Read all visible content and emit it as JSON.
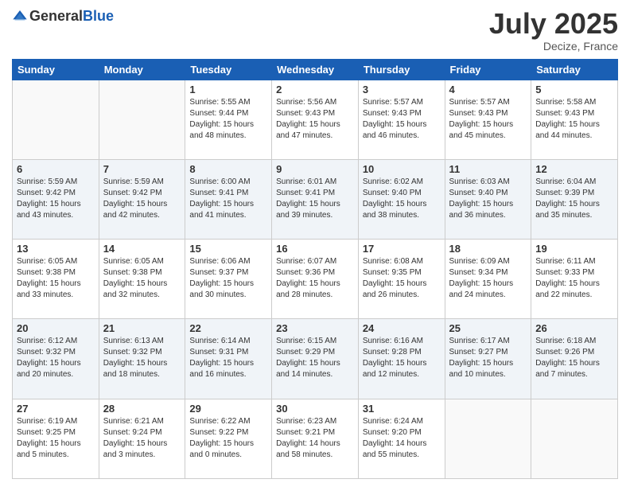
{
  "header": {
    "logo_general": "General",
    "logo_blue": "Blue",
    "month_year": "July 2025",
    "location": "Decize, France"
  },
  "weekdays": [
    "Sunday",
    "Monday",
    "Tuesday",
    "Wednesday",
    "Thursday",
    "Friday",
    "Saturday"
  ],
  "weeks": [
    [
      {
        "day": "",
        "info": ""
      },
      {
        "day": "",
        "info": ""
      },
      {
        "day": "1",
        "info": "Sunrise: 5:55 AM\nSunset: 9:44 PM\nDaylight: 15 hours\nand 48 minutes."
      },
      {
        "day": "2",
        "info": "Sunrise: 5:56 AM\nSunset: 9:43 PM\nDaylight: 15 hours\nand 47 minutes."
      },
      {
        "day": "3",
        "info": "Sunrise: 5:57 AM\nSunset: 9:43 PM\nDaylight: 15 hours\nand 46 minutes."
      },
      {
        "day": "4",
        "info": "Sunrise: 5:57 AM\nSunset: 9:43 PM\nDaylight: 15 hours\nand 45 minutes."
      },
      {
        "day": "5",
        "info": "Sunrise: 5:58 AM\nSunset: 9:43 PM\nDaylight: 15 hours\nand 44 minutes."
      }
    ],
    [
      {
        "day": "6",
        "info": "Sunrise: 5:59 AM\nSunset: 9:42 PM\nDaylight: 15 hours\nand 43 minutes."
      },
      {
        "day": "7",
        "info": "Sunrise: 5:59 AM\nSunset: 9:42 PM\nDaylight: 15 hours\nand 42 minutes."
      },
      {
        "day": "8",
        "info": "Sunrise: 6:00 AM\nSunset: 9:41 PM\nDaylight: 15 hours\nand 41 minutes."
      },
      {
        "day": "9",
        "info": "Sunrise: 6:01 AM\nSunset: 9:41 PM\nDaylight: 15 hours\nand 39 minutes."
      },
      {
        "day": "10",
        "info": "Sunrise: 6:02 AM\nSunset: 9:40 PM\nDaylight: 15 hours\nand 38 minutes."
      },
      {
        "day": "11",
        "info": "Sunrise: 6:03 AM\nSunset: 9:40 PM\nDaylight: 15 hours\nand 36 minutes."
      },
      {
        "day": "12",
        "info": "Sunrise: 6:04 AM\nSunset: 9:39 PM\nDaylight: 15 hours\nand 35 minutes."
      }
    ],
    [
      {
        "day": "13",
        "info": "Sunrise: 6:05 AM\nSunset: 9:38 PM\nDaylight: 15 hours\nand 33 minutes."
      },
      {
        "day": "14",
        "info": "Sunrise: 6:05 AM\nSunset: 9:38 PM\nDaylight: 15 hours\nand 32 minutes."
      },
      {
        "day": "15",
        "info": "Sunrise: 6:06 AM\nSunset: 9:37 PM\nDaylight: 15 hours\nand 30 minutes."
      },
      {
        "day": "16",
        "info": "Sunrise: 6:07 AM\nSunset: 9:36 PM\nDaylight: 15 hours\nand 28 minutes."
      },
      {
        "day": "17",
        "info": "Sunrise: 6:08 AM\nSunset: 9:35 PM\nDaylight: 15 hours\nand 26 minutes."
      },
      {
        "day": "18",
        "info": "Sunrise: 6:09 AM\nSunset: 9:34 PM\nDaylight: 15 hours\nand 24 minutes."
      },
      {
        "day": "19",
        "info": "Sunrise: 6:11 AM\nSunset: 9:33 PM\nDaylight: 15 hours\nand 22 minutes."
      }
    ],
    [
      {
        "day": "20",
        "info": "Sunrise: 6:12 AM\nSunset: 9:32 PM\nDaylight: 15 hours\nand 20 minutes."
      },
      {
        "day": "21",
        "info": "Sunrise: 6:13 AM\nSunset: 9:32 PM\nDaylight: 15 hours\nand 18 minutes."
      },
      {
        "day": "22",
        "info": "Sunrise: 6:14 AM\nSunset: 9:31 PM\nDaylight: 15 hours\nand 16 minutes."
      },
      {
        "day": "23",
        "info": "Sunrise: 6:15 AM\nSunset: 9:29 PM\nDaylight: 15 hours\nand 14 minutes."
      },
      {
        "day": "24",
        "info": "Sunrise: 6:16 AM\nSunset: 9:28 PM\nDaylight: 15 hours\nand 12 minutes."
      },
      {
        "day": "25",
        "info": "Sunrise: 6:17 AM\nSunset: 9:27 PM\nDaylight: 15 hours\nand 10 minutes."
      },
      {
        "day": "26",
        "info": "Sunrise: 6:18 AM\nSunset: 9:26 PM\nDaylight: 15 hours\nand 7 minutes."
      }
    ],
    [
      {
        "day": "27",
        "info": "Sunrise: 6:19 AM\nSunset: 9:25 PM\nDaylight: 15 hours\nand 5 minutes."
      },
      {
        "day": "28",
        "info": "Sunrise: 6:21 AM\nSunset: 9:24 PM\nDaylight: 15 hours\nand 3 minutes."
      },
      {
        "day": "29",
        "info": "Sunrise: 6:22 AM\nSunset: 9:22 PM\nDaylight: 15 hours\nand 0 minutes."
      },
      {
        "day": "30",
        "info": "Sunrise: 6:23 AM\nSunset: 9:21 PM\nDaylight: 14 hours\nand 58 minutes."
      },
      {
        "day": "31",
        "info": "Sunrise: 6:24 AM\nSunset: 9:20 PM\nDaylight: 14 hours\nand 55 minutes."
      },
      {
        "day": "",
        "info": ""
      },
      {
        "day": "",
        "info": ""
      }
    ]
  ]
}
